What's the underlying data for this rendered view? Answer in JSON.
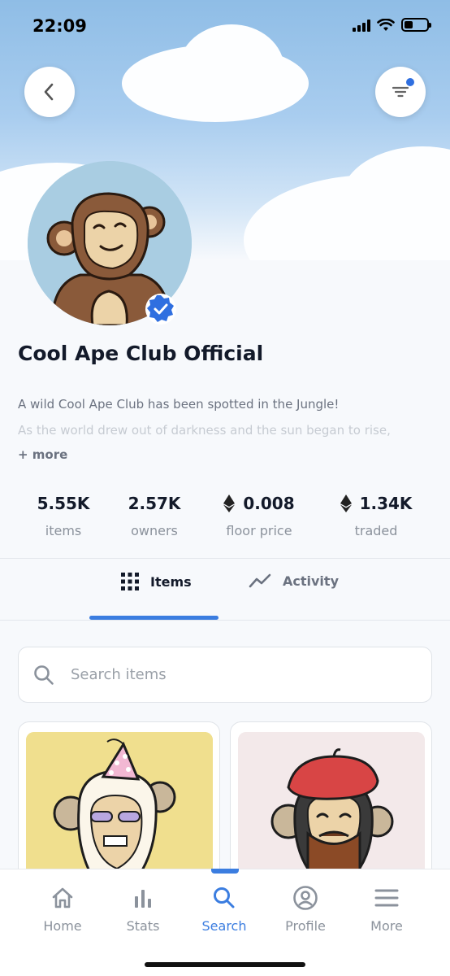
{
  "status_bar": {
    "time": "22:09"
  },
  "header": {
    "back_icon": "chevron-left-icon",
    "filter_icon": "filter-icon",
    "filter_badge_color": "#2f6fe0"
  },
  "collection": {
    "title": "Cool Ape Club Official",
    "verified_icon": "verified-badge-icon",
    "description_line1": "A wild Cool Ape Club has been spotted in the Jungle!",
    "description_line2": "As the world drew out of darkness and the sun began to rise,",
    "more_label": "+ more"
  },
  "stats": [
    {
      "value": "5.55K",
      "label": "items"
    },
    {
      "value": "2.57K",
      "label": "owners"
    },
    {
      "value": "0.008",
      "label": "floor price",
      "icon": "ethereum-icon"
    },
    {
      "value": "1.34K",
      "label": "traded",
      "icon": "ethereum-icon"
    }
  ],
  "tabs": [
    {
      "label": "Items",
      "icon": "grid-icon",
      "active": true
    },
    {
      "label": "Activity",
      "icon": "trend-line-icon",
      "active": false
    }
  ],
  "search": {
    "placeholder": "Search items",
    "value": ""
  },
  "items": [
    {
      "name": "party-hat-ape",
      "bg_color": "#f0df8e"
    },
    {
      "name": "beret-ape",
      "bg_color": "#f3e9ea"
    }
  ],
  "bottom_nav": [
    {
      "label": "Home",
      "icon": "home-icon",
      "active": false
    },
    {
      "label": "Stats",
      "icon": "bar-chart-icon",
      "active": false
    },
    {
      "label": "Search",
      "icon": "search-icon",
      "active": true
    },
    {
      "label": "Profile",
      "icon": "profile-icon",
      "active": false
    },
    {
      "label": "More",
      "icon": "menu-icon",
      "active": false
    }
  ],
  "colors": {
    "accent": "#3b7de0",
    "text": "#131a2a",
    "muted": "#8b929c"
  }
}
